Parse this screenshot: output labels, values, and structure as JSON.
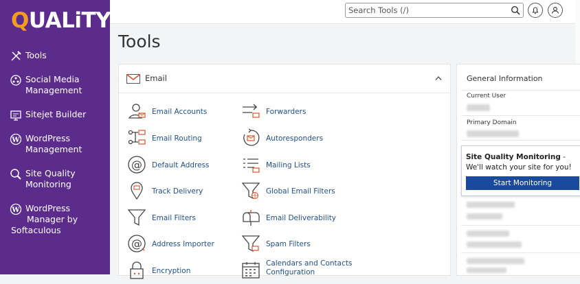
{
  "brand": {
    "logo_q": "Q",
    "logo_rest": "UALiTY"
  },
  "sidebar": {
    "items": [
      {
        "label": "Tools",
        "icon": "tools-icon"
      },
      {
        "label_l1": "Social Media",
        "label_l2": "Management",
        "icon": "social-media-icon"
      },
      {
        "label": "Sitejet Builder",
        "icon": "sitejet-icon"
      },
      {
        "label_l1": "WordPress",
        "label_l2": "Management",
        "icon": "wordpress-icon"
      },
      {
        "label_l1": "Site Quality",
        "label_l2": "Monitoring",
        "icon": "site-quality-icon"
      },
      {
        "label_l1": "WordPress",
        "label_l2": "Manager by",
        "label_l3": "Softaculous",
        "icon": "wordpress-icon"
      }
    ]
  },
  "topbar": {
    "search_placeholder": "Search Tools (/)"
  },
  "page": {
    "title": "Tools"
  },
  "email_section": {
    "title": "Email",
    "tools": [
      "Email Accounts",
      "Forwarders",
      "Email Routing",
      "Autoresponders",
      "Default Address",
      "Mailing Lists",
      "Track Delivery",
      "Global Email Filters",
      "Email Filters",
      "Email Deliverability",
      "Address Importer",
      "Spam Filters",
      "Encryption",
      "Calendars and Contacts Configuration"
    ]
  },
  "general_info": {
    "title": "General Information",
    "current_user_label": "Current User",
    "primary_domain_label": "Primary Domain"
  },
  "site_quality_popup": {
    "bold": "Site Quality Monitoring",
    "rest": " - We'll watch your site for you!",
    "button": "Start Monitoring"
  },
  "colors": {
    "sidebar": "#5b2c8c",
    "accent": "#f39c1e",
    "link": "#1f4f8a",
    "button": "#1a4a9c"
  }
}
